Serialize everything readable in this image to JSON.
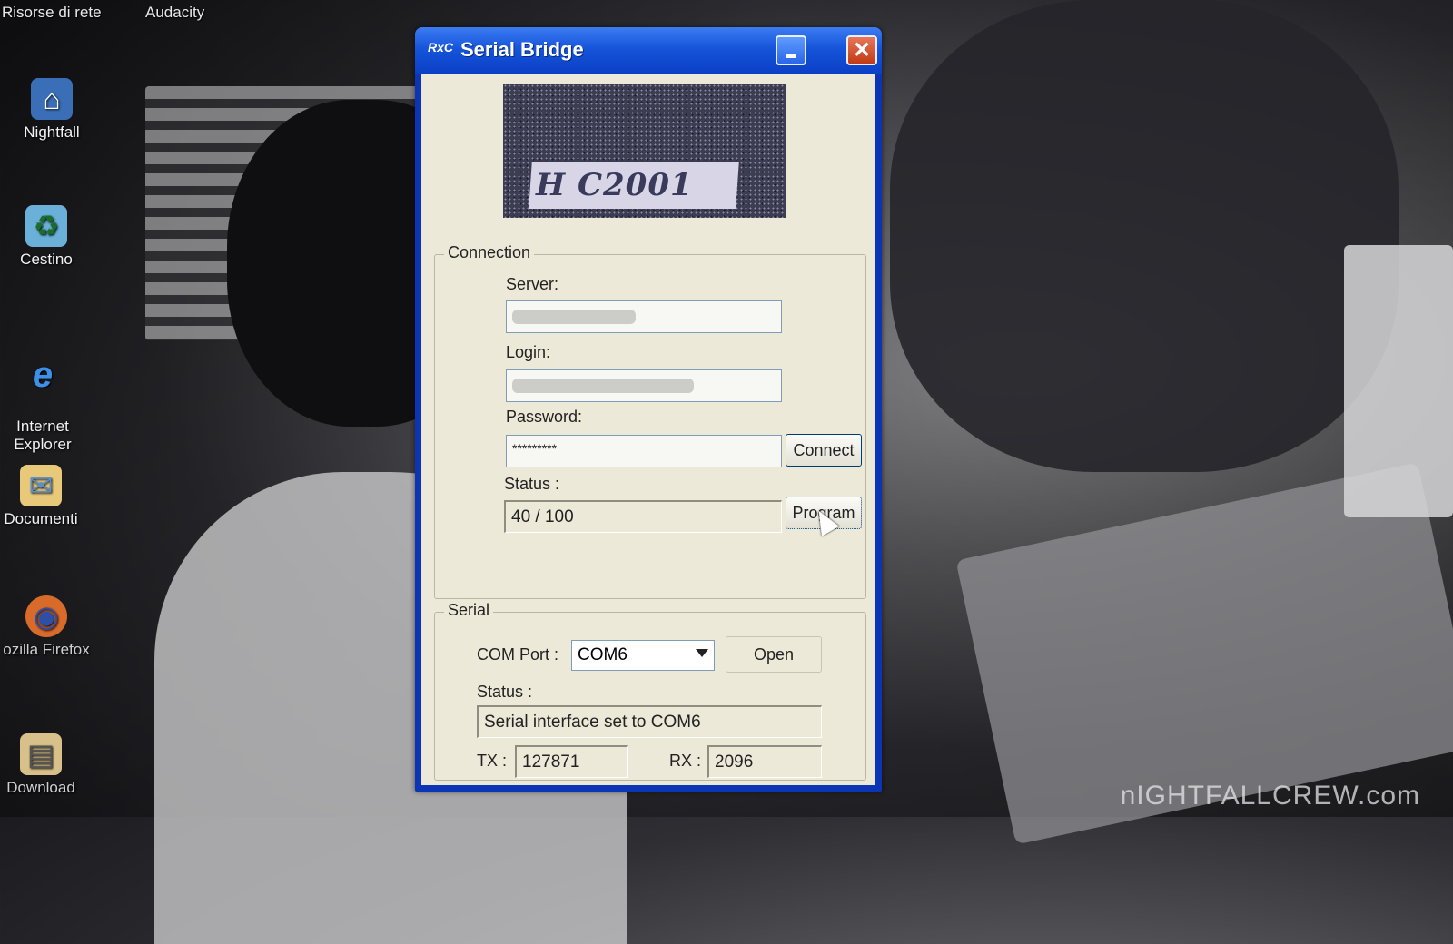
{
  "desktop": {
    "top_labels": [
      "Risorse di rete",
      "Audacity"
    ],
    "icons": [
      {
        "label": "Nightfall",
        "icon": "network-computer-icon"
      },
      {
        "label": "Cestino",
        "icon": "recycle-bin-icon"
      },
      {
        "label": "Internet\nExplorer",
        "icon": "internet-explorer-icon"
      },
      {
        "label": "Documenti",
        "icon": "documents-folder-icon"
      },
      {
        "label": "ozilla Firefox",
        "icon": "firefox-icon"
      },
      {
        "label": "Download",
        "icon": "download-folder-icon"
      }
    ],
    "watermark": "nIGHTFALLCREW.com"
  },
  "window": {
    "app_icon_text": "RxC",
    "title": "Serial Bridge",
    "banner_text": "H C2001",
    "connection": {
      "group_label": "Connection",
      "server_label": "Server:",
      "server_value": "",
      "login_label": "Login:",
      "login_value": "",
      "password_label": "Password:",
      "password_value": "*********",
      "connect_button": "Connect",
      "status_label": "Status :",
      "status_value": "40 / 100",
      "program_button": "Program"
    },
    "serial": {
      "group_label": "Serial",
      "com_port_label": "COM Port :",
      "com_port_value": "COM6",
      "open_button": "Open",
      "status_label": "Status :",
      "status_value": "Serial interface set to COM6",
      "tx_label": "TX :",
      "tx_value": "127871",
      "rx_label": "RX :",
      "rx_value": "2096"
    }
  },
  "colors": {
    "titlebar": "#1654da",
    "client": "#ece9d8",
    "close_button": "#c23a14"
  }
}
